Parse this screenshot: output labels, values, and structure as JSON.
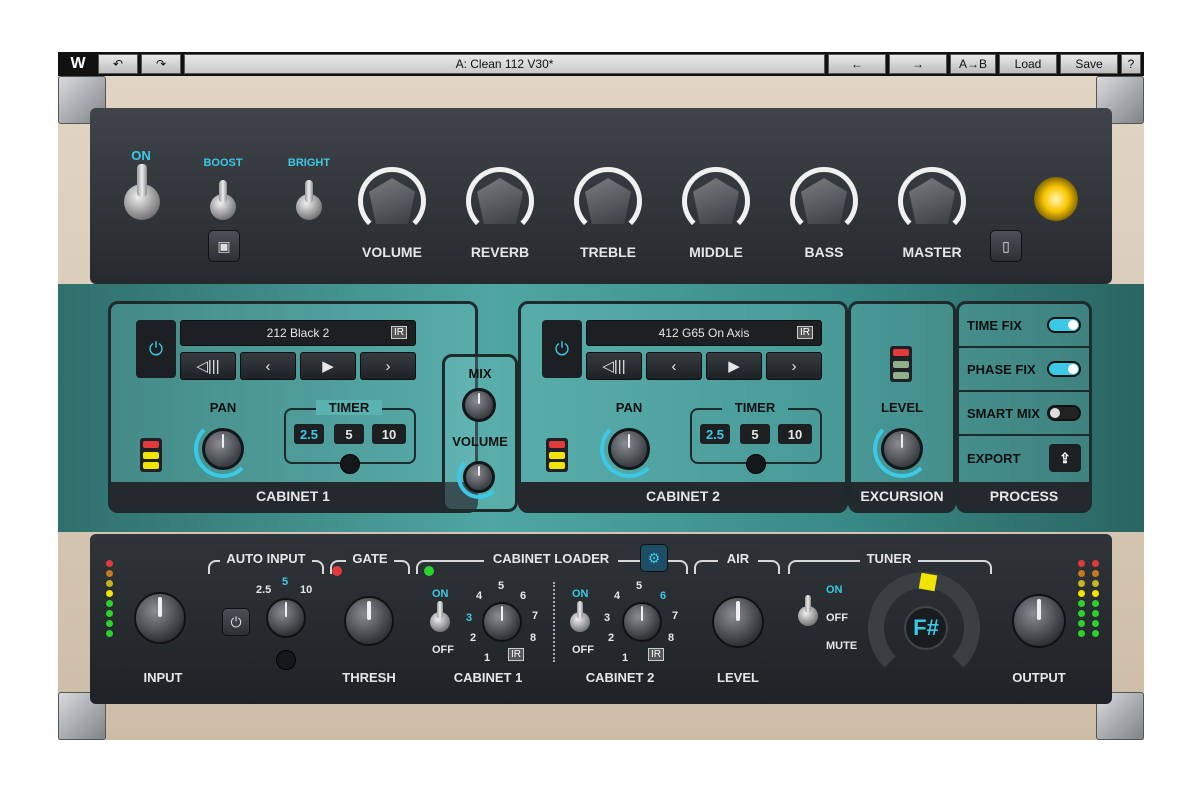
{
  "topbar": {
    "logo": "W",
    "undo": "↶",
    "redo": "↷",
    "preset_name": "A: Clean 112 V30*",
    "prev": "←",
    "next": "→",
    "ab": "A→B",
    "load": "Load",
    "save": "Save",
    "help": "?"
  },
  "amp": {
    "on": "ON",
    "boost": "BOOST",
    "bright": "BRIGHT",
    "knobs": [
      "VOLUME",
      "REVERB",
      "TREBLE",
      "MIDDLE",
      "BASS",
      "MASTER"
    ]
  },
  "cabinet1": {
    "ir_name": "212 Black 2",
    "ir_badge": "IR",
    "pan": "PAN",
    "timer": "TIMER",
    "timer_opts": [
      "2.5",
      "5",
      "10"
    ],
    "footer": "CABINET 1"
  },
  "cabinet2": {
    "ir_name": "412 G65 On Axis",
    "ir_badge": "IR",
    "pan": "PAN",
    "timer": "TIMER",
    "timer_opts": [
      "2.5",
      "5",
      "10"
    ],
    "footer": "CABINET 2"
  },
  "mix": {
    "mix": "MIX",
    "volume": "VOLUME"
  },
  "excursion": {
    "level": "LEVEL",
    "footer": "EXCURSION"
  },
  "process": {
    "time_fix": "TIME FIX",
    "phase_fix": "PHASE FIX",
    "smart_mix": "SMART MIX",
    "export": "EXPORT",
    "footer": "PROCESS"
  },
  "bottom": {
    "input": "INPUT",
    "auto_input": "AUTO INPUT",
    "ai_nums": [
      "2.5",
      "5",
      "10"
    ],
    "gate": "GATE",
    "thresh": "THRESH",
    "cab_loader": "CABINET LOADER",
    "cab1": "CABINET 1",
    "cab2": "CABINET 2",
    "on": "ON",
    "off": "OFF",
    "ir": "IR",
    "air": "AIR",
    "level": "LEVEL",
    "tuner": "TUNER",
    "t_on": "ON",
    "t_off": "OFF",
    "t_mute": "MUTE",
    "note": "F#",
    "output": "OUTPUT",
    "cab_nums": [
      "1",
      "2",
      "3",
      "4",
      "5",
      "6",
      "7",
      "8"
    ]
  },
  "colors": {
    "accent": "#3cc9e6",
    "led_green": "#2bd42b",
    "led_yellow": "#f2e400",
    "led_red": "#e23a3a"
  }
}
